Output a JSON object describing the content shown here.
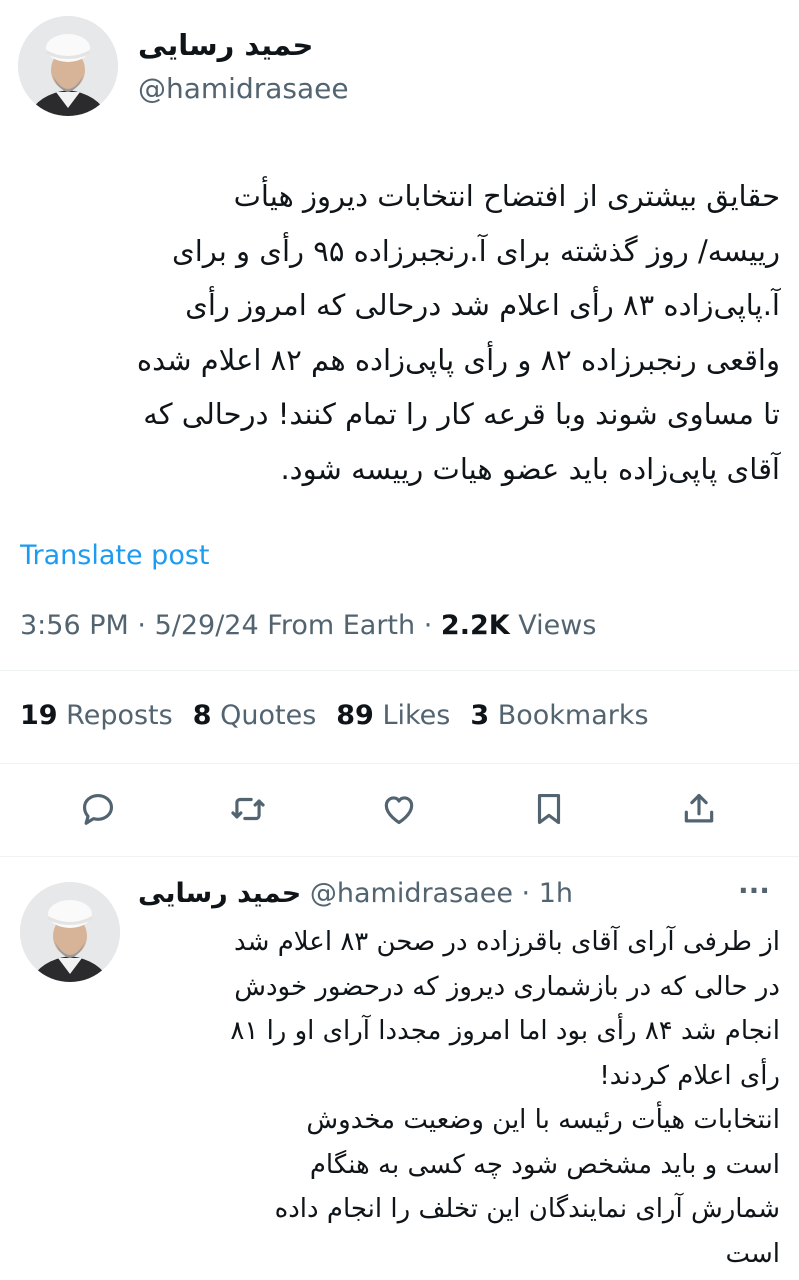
{
  "main_tweet": {
    "author_name": "حمید رسایی",
    "author_handle": "@hamidrasaee",
    "text": "حقایق بیشتری از افتضاح انتخابات دیروز هیأت\nرییسه/ روز گذشته برای آ.رنجبرزاده ۹۵ رأی و برای\nآ.پاپی‌زاده ۸۳ رأی اعلام شد درحالی که امروز رأی\nواقعی رنجبرزاده ۸۲ و رأی پاپی‌زاده هم ۸۲ اعلام شده\nتا مساوی شوند وبا قرعه کار را تمام کنند! درحالی که\nآقای پاپی‌زاده باید عضو هیات رییسه شود.",
    "translate_label": "Translate post",
    "time": "3:56 PM",
    "date": "5/29/24",
    "source": "From Earth",
    "views_count": "2.2K",
    "views_label": "Views",
    "stats": {
      "reposts_count": "19",
      "reposts_label": "Reposts",
      "quotes_count": "8",
      "quotes_label": "Quotes",
      "likes_count": "89",
      "likes_label": "Likes",
      "bookmarks_count": "3",
      "bookmarks_label": "Bookmarks"
    },
    "actions": [
      "reply-icon",
      "repost-icon",
      "like-icon",
      "bookmark-icon",
      "share-icon"
    ]
  },
  "reply_tweet": {
    "author_name": "حمید رسایی",
    "author_handle": "@hamidrasaee",
    "time_ago": "1h",
    "more_label": "···",
    "text": "از طرفی آرای آقای باقرزاده در صحن ۸۳ اعلام شد\nدر حالی که در بازشماری دیروز که درحضور خودش\nانجام شد ۸۴ رأی بود اما امروز مجددا آرای او را ۸۱\nرأی اعلام کردند!\nانتخابات هیأت رئیسه با این وضعیت مخدوش\nاست و باید مشخص شود چه کسی به هنگام\nشمارش آرای نمایندگان این تخلف را انجام داده\nاست"
  },
  "colors": {
    "text": "#0f1419",
    "secondary": "#536471",
    "link": "#1d9bf0",
    "divider": "#eff3f4"
  }
}
